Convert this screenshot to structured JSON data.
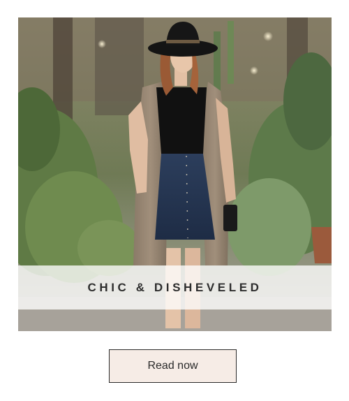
{
  "article": {
    "title": "CHIC & DISHEVELED",
    "image_subject": "fashion-photo"
  },
  "cta": {
    "label": "Read now"
  },
  "colors": {
    "button_background": "#f6ece6",
    "button_border": "#2a2a2a",
    "band_background": "#ffffffc7",
    "title_text": "#2d2d2d"
  }
}
